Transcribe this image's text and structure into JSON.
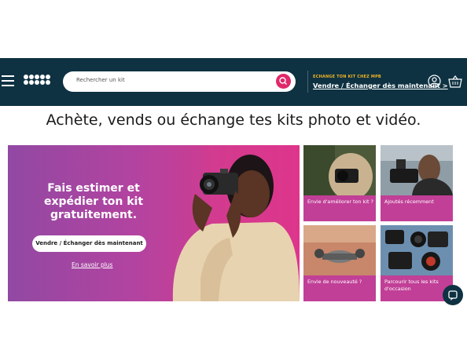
{
  "header": {
    "search_placeholder": "Rechercher un kit",
    "promo_small": "ECHANGE TON KIT CHEZ MPB",
    "promo_link": "Vendre / Échanger dès maintenant >"
  },
  "headline": "Achète, vends ou échange tes kits photo et vidéo.",
  "hero": {
    "title_line1": "Fais estimer et",
    "title_line2": "expédier ton kit",
    "title_line3": "gratuitement.",
    "button": "Vendre / Échanger dès maintenant",
    "link": "En savoir plus"
  },
  "tiles": [
    {
      "label": "Envie d'améliorer ton kit ?"
    },
    {
      "label": "Ajoutés récemment"
    },
    {
      "label": "Envie de nouveauté ?"
    },
    {
      "label": "Parcourir tous les kits d'occasion"
    }
  ],
  "colors": {
    "header_bg": "#0e3242",
    "accent": "#e0286a",
    "promo_yellow": "#f0b323"
  }
}
